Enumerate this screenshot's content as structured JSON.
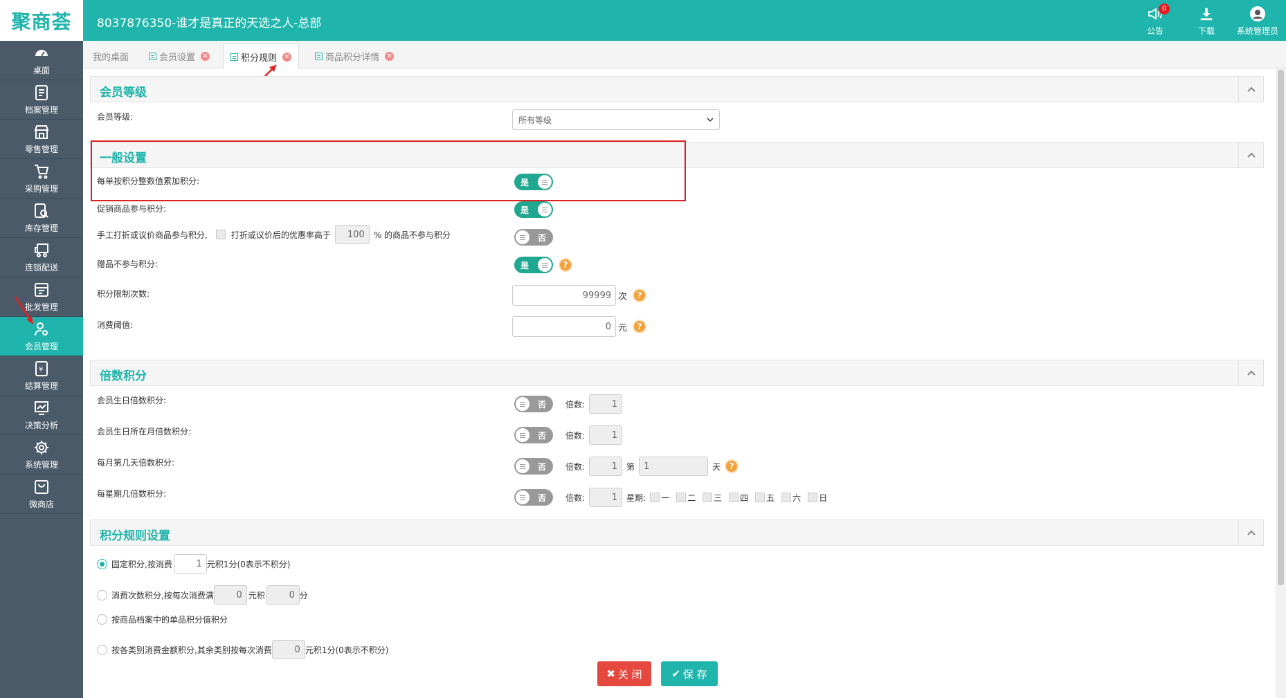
{
  "header": {
    "logo": "聚商荟",
    "title": "8037876350-谁才是真正的天选之人-总部",
    "actions": [
      {
        "label": "公告",
        "icon": "megaphone-icon",
        "badge": "0"
      },
      {
        "label": "下载",
        "icon": "download-icon"
      },
      {
        "label": "系统管理员",
        "icon": "user-avatar-icon"
      }
    ]
  },
  "sidebar": {
    "items": [
      {
        "label": "桌面",
        "icon": "dashboard-icon"
      },
      {
        "label": "档案管理",
        "icon": "archive-icon"
      },
      {
        "label": "零售管理",
        "icon": "store-icon"
      },
      {
        "label": "采购管理",
        "icon": "cart-icon"
      },
      {
        "label": "库存管理",
        "icon": "inventory-icon"
      },
      {
        "label": "连锁配送",
        "icon": "truck-icon"
      },
      {
        "label": "批发管理",
        "icon": "wholesale-icon"
      },
      {
        "label": "会员管理",
        "icon": "member-icon",
        "active": true
      },
      {
        "label": "结算管理",
        "icon": "settlement-icon"
      },
      {
        "label": "决策分析",
        "icon": "chart-icon"
      },
      {
        "label": "系统管理",
        "icon": "gear-icon"
      },
      {
        "label": "微商店",
        "icon": "shop-bag-icon"
      }
    ]
  },
  "tabs": [
    {
      "label": "我的桌面"
    },
    {
      "label": "会员设置"
    },
    {
      "label": "积分规则",
      "active": true
    },
    {
      "label": "商品积分详情"
    }
  ],
  "sections": {
    "level": {
      "title": "会员等级",
      "row_label": "会员等级:",
      "select_value": "所有等级"
    },
    "general": {
      "title": "一般设置",
      "rows": {
        "integer_points": {
          "label": "每单按积分整数值累加积分:",
          "toggle": "是"
        },
        "promo_points": {
          "label": "促销商品参与积分:",
          "toggle": "是"
        },
        "manual_discount": {
          "label": "手工打折或议价商品参与积分,",
          "check_text": "打折或议价后的优惠率高于",
          "value": "100",
          "suffix": "% 的商品不参与积分",
          "toggle": "否"
        },
        "gift_points": {
          "label": "赠品不参与积分:",
          "toggle": "是"
        },
        "limit_times": {
          "label": "积分限制次数:",
          "value": "99999",
          "unit": "次"
        },
        "threshold": {
          "label": "消费阈值:",
          "value": "0",
          "unit": "元"
        }
      }
    },
    "multiple": {
      "title": "倍数积分",
      "multiplier_label": "倍数:",
      "rows": {
        "birthday": {
          "label": "会员生日倍数积分:",
          "toggle": "否",
          "value": "1"
        },
        "birth_month": {
          "label": "会员生日所在月倍数积分:",
          "toggle": "否",
          "value": "1"
        },
        "month_day": {
          "label": "每月第几天倍数积分:",
          "toggle": "否",
          "value": "1",
          "day_prefix": "第",
          "day_value": "1",
          "day_unit": "天"
        },
        "weekday": {
          "label": "每星期几倍数积分:",
          "toggle": "否",
          "value": "1",
          "week_prefix": "星期:",
          "days": [
            "一",
            "二",
            "三",
            "四",
            "五",
            "六",
            "日"
          ]
        }
      }
    },
    "rules": {
      "title": "积分规则设置",
      "options": {
        "fixed": {
          "text1": "固定积分,按消费",
          "value": "1",
          "text2": "元积1分(0表示不积分)",
          "selected": true
        },
        "count": {
          "text1": "消费次数积分,按每次消费满",
          "value1": "0",
          "text2": "元积",
          "value2": "0",
          "text3": "分"
        },
        "item": {
          "text1": "按商品档案中的单品积分值积分"
        },
        "category": {
          "text1": "按各类别消费金额积分,其余类别按每次消费",
          "value": "0",
          "text2": "元积1分(0表示不积分)"
        }
      }
    }
  },
  "buttons": {
    "close": "关 闭",
    "save": "保 存"
  },
  "colors": {
    "accent": "#1fb5ac",
    "sidebar": "#4a5a69",
    "danger": "#e4483e",
    "help": "#f5a03a"
  }
}
